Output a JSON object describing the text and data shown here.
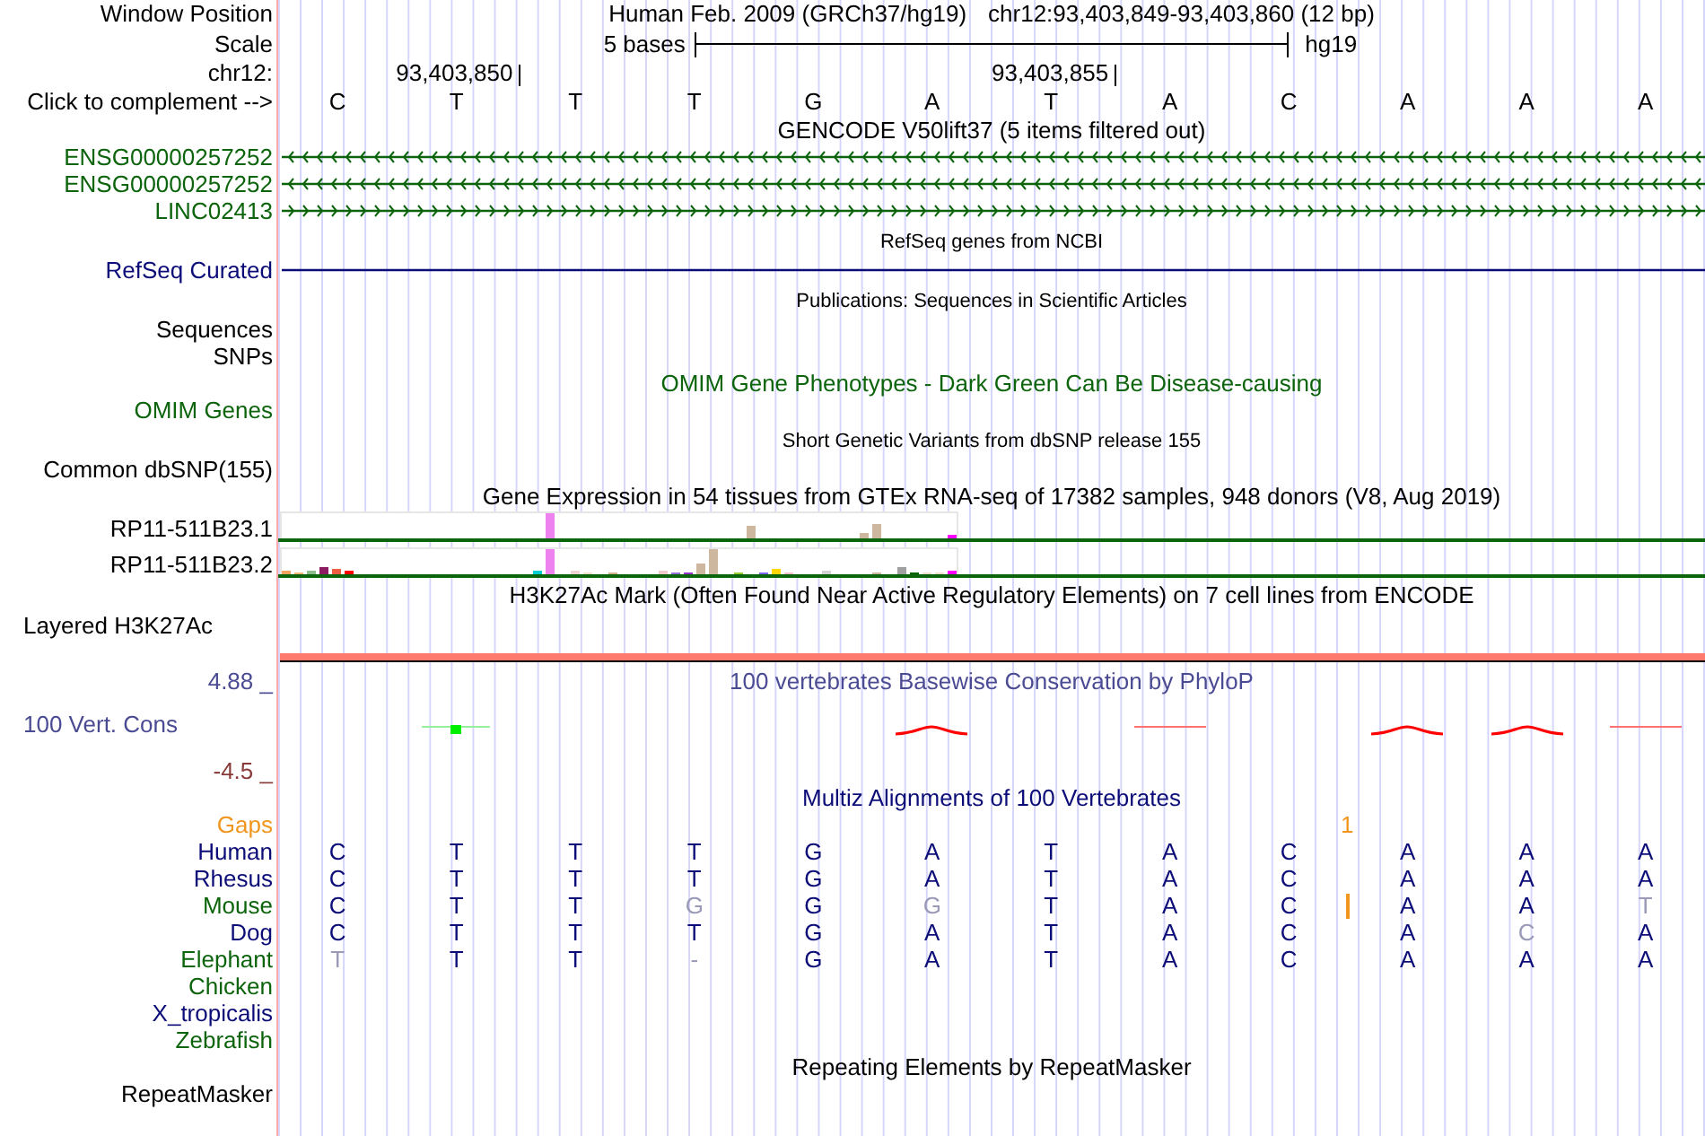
{
  "position": {
    "label": "Window Position",
    "assembly": "Human Feb. 2009 (GRCh37/hg19)",
    "range": "chr12:93,403,849-93,403,860 (12 bp)"
  },
  "scale": {
    "label": "Scale",
    "text": "5 bases",
    "assembly": "hg19"
  },
  "sequence": {
    "ruler_label": "chr12:",
    "label": "Click to complement -->",
    "bases": [
      {
        "base": "C"
      },
      {
        "base": "T",
        "coordinate": "93,403,850"
      },
      {
        "base": "T"
      },
      {
        "base": "T"
      },
      {
        "base": "G"
      },
      {
        "base": "A"
      },
      {
        "base": "T",
        "coordinate": "93,403,855"
      },
      {
        "base": "A"
      },
      {
        "base": "C"
      },
      {
        "base": "A"
      },
      {
        "base": "A"
      },
      {
        "base": "A"
      }
    ]
  },
  "tracks": [
    {
      "kind": "genes",
      "super_track": false,
      "title": "GENCODE V50lift37 (5 items filtered out)",
      "color": "#000000",
      "rows": [
        {
          "kind": "reverse",
          "label": "ENSG00000257252",
          "color": "#0c640c"
        },
        {
          "kind": "reverse",
          "label": "ENSG00000257252",
          "color": "#0c640c"
        },
        {
          "kind": "forward",
          "label": "LINC02413",
          "color": "#0c640c"
        }
      ]
    },
    {
      "kind": "genes",
      "super_track": true,
      "title": "RefSeq genes from NCBI",
      "color": "#000000",
      "rows": [
        {
          "kind": "plain",
          "label": "RefSeq Curated",
          "color": "#0c0c78"
        }
      ]
    },
    {
      "kind": "empty",
      "super_track": true,
      "title": "Publications: Sequences in Scientific Articles",
      "color": "#000000",
      "rows": [
        {
          "label": "Sequences",
          "color": "#000000"
        },
        {
          "label": "SNPs",
          "color": "#000000"
        }
      ]
    },
    {
      "kind": "empty",
      "super_track": false,
      "title": "OMIM Gene Phenotypes - Dark Green Can Be Disease-causing",
      "color": "#0c640c",
      "rows": [
        {
          "label": "OMIM Genes",
          "color": "#0c640c"
        }
      ]
    },
    {
      "kind": "empty",
      "super_track": true,
      "title": "Short Genetic Variants from dbSNP release 155",
      "color": "#000000",
      "rows": [
        {
          "label": "Common dbSNP(155)",
          "color": "#000000"
        }
      ]
    },
    {
      "kind": "expression",
      "super_track": false,
      "title": "Gene Expression in 54 tissues from GTEx RNA-seq of 17382 samples, 948 donors (V8, Aug 2019)",
      "color": "#000000",
      "rows": [
        {
          "label": "RP11-511B23.1",
          "color": "#000000"
        },
        {
          "label": "RP11-511B23.2",
          "color": "#000000"
        }
      ]
    },
    {
      "kind": "signal",
      "super_track": false,
      "title": "H3K27Ac Mark (Often Found Near Active Regulatory Elements) on 7 cell lines from ENCODE",
      "color": "#000000",
      "rows": [
        {
          "label": "Layered H3K27Ac",
          "color": "#000000"
        }
      ]
    },
    {
      "kind": "conservation",
      "super_track": false,
      "title": "100 vertebrates Basewise Conservation by PhyloP",
      "color": "#4b4b94",
      "rows": [
        {
          "label": "100 Vert. Cons",
          "color": "#4b4b94",
          "max": {
            "text": "4.88 _",
            "color": "#4b4b94"
          },
          "min": {
            "text": "-4.5 _",
            "color": "#8b3a3a"
          }
        }
      ]
    },
    {
      "kind": "alignment",
      "super_track": false,
      "title": "Multiz Alignments of 100 Vertebrates",
      "color": "#0c0c78",
      "gaps": {
        "label": "Gaps",
        "color": "#f0961e",
        "count": "1"
      },
      "rows": [
        {
          "label": "Human",
          "color": "#0c0c78",
          "bases": [
            {
              "kind": "base",
              "base": "C",
              "match": true
            },
            {
              "kind": "base",
              "base": "T",
              "match": true
            },
            {
              "kind": "base",
              "base": "T",
              "match": true
            },
            {
              "kind": "base",
              "base": "T",
              "match": true
            },
            {
              "kind": "base",
              "base": "G",
              "match": true
            },
            {
              "kind": "base",
              "base": "A",
              "match": true
            },
            {
              "kind": "base",
              "base": "T",
              "match": true
            },
            {
              "kind": "base",
              "base": "A",
              "match": true
            },
            {
              "kind": "base",
              "base": "C",
              "match": true
            },
            {
              "kind": "base",
              "base": "A",
              "match": true
            },
            {
              "kind": "base",
              "base": "A",
              "match": true
            },
            {
              "kind": "base",
              "base": "A",
              "match": true
            }
          ]
        },
        {
          "label": "Rhesus",
          "color": "#0c0c78",
          "bases": [
            {
              "kind": "base",
              "base": "C",
              "match": true
            },
            {
              "kind": "base",
              "base": "T",
              "match": true
            },
            {
              "kind": "base",
              "base": "T",
              "match": true
            },
            {
              "kind": "base",
              "base": "T",
              "match": true
            },
            {
              "kind": "base",
              "base": "G",
              "match": true
            },
            {
              "kind": "base",
              "base": "A",
              "match": true
            },
            {
              "kind": "base",
              "base": "T",
              "match": true
            },
            {
              "kind": "base",
              "base": "A",
              "match": true
            },
            {
              "kind": "base",
              "base": "C",
              "match": true
            },
            {
              "kind": "base",
              "base": "A",
              "match": true
            },
            {
              "kind": "base",
              "base": "A",
              "match": true
            },
            {
              "kind": "base",
              "base": "A",
              "match": true
            }
          ]
        },
        {
          "label": "Mouse",
          "color": "#0c640c",
          "bases": [
            {
              "kind": "base",
              "base": "C",
              "match": true
            },
            {
              "kind": "base",
              "base": "T",
              "match": true
            },
            {
              "kind": "base",
              "base": "T",
              "match": true
            },
            {
              "kind": "base",
              "base": "G",
              "match": false
            },
            {
              "kind": "base",
              "base": "G",
              "match": true
            },
            {
              "kind": "base",
              "base": "G",
              "match": false
            },
            {
              "kind": "base",
              "base": "T",
              "match": true
            },
            {
              "kind": "base",
              "base": "A",
              "match": true
            },
            {
              "kind": "base",
              "base": "C",
              "match": true
            },
            {
              "kind": "insertion"
            },
            {
              "kind": "base",
              "base": "A",
              "match": true
            },
            {
              "kind": "base",
              "base": "A",
              "match": true
            },
            {
              "kind": "base",
              "base": "T",
              "match": false
            }
          ]
        },
        {
          "label": "Dog",
          "color": "#0c0c78",
          "bases": [
            {
              "kind": "base",
              "base": "C",
              "match": true
            },
            {
              "kind": "base",
              "base": "T",
              "match": true
            },
            {
              "kind": "base",
              "base": "T",
              "match": true
            },
            {
              "kind": "base",
              "base": "T",
              "match": true
            },
            {
              "kind": "base",
              "base": "G",
              "match": true
            },
            {
              "kind": "base",
              "base": "A",
              "match": true
            },
            {
              "kind": "base",
              "base": "T",
              "match": true
            },
            {
              "kind": "base",
              "base": "A",
              "match": true
            },
            {
              "kind": "base",
              "base": "C",
              "match": true
            },
            {
              "kind": "base",
              "base": "A",
              "match": true
            },
            {
              "kind": "base",
              "base": "C",
              "match": false
            },
            {
              "kind": "base",
              "base": "A",
              "match": true
            }
          ]
        },
        {
          "label": "Elephant",
          "color": "#0c640c",
          "bases": [
            {
              "kind": "base",
              "base": "T",
              "match": false
            },
            {
              "kind": "base",
              "base": "T",
              "match": true
            },
            {
              "kind": "base",
              "base": "T",
              "match": true
            },
            {
              "kind": "base",
              "base": "-",
              "match": false
            },
            {
              "kind": "base",
              "base": "G",
              "match": true
            },
            {
              "kind": "base",
              "base": "A",
              "match": true
            },
            {
              "kind": "base",
              "base": "T",
              "match": true
            },
            {
              "kind": "base",
              "base": "A",
              "match": true
            },
            {
              "kind": "base",
              "base": "C",
              "match": true
            },
            {
              "kind": "base",
              "base": "A",
              "match": true
            },
            {
              "kind": "base",
              "base": "A",
              "match": true
            },
            {
              "kind": "base",
              "base": "A",
              "match": true
            }
          ]
        },
        {
          "label": "Chicken",
          "color": "#0c640c"
        },
        {
          "label": "X_tropicalis",
          "color": "#0c0c78"
        },
        {
          "label": "Zebrafish",
          "color": "#0c640c"
        }
      ]
    },
    {
      "kind": "empty",
      "super_track": false,
      "title": "Repeating Elements by RepeatMasker",
      "color": "#000000",
      "rows": [
        {
          "label": "RepeatMasker",
          "color": "#000000"
        }
      ]
    }
  ]
}
